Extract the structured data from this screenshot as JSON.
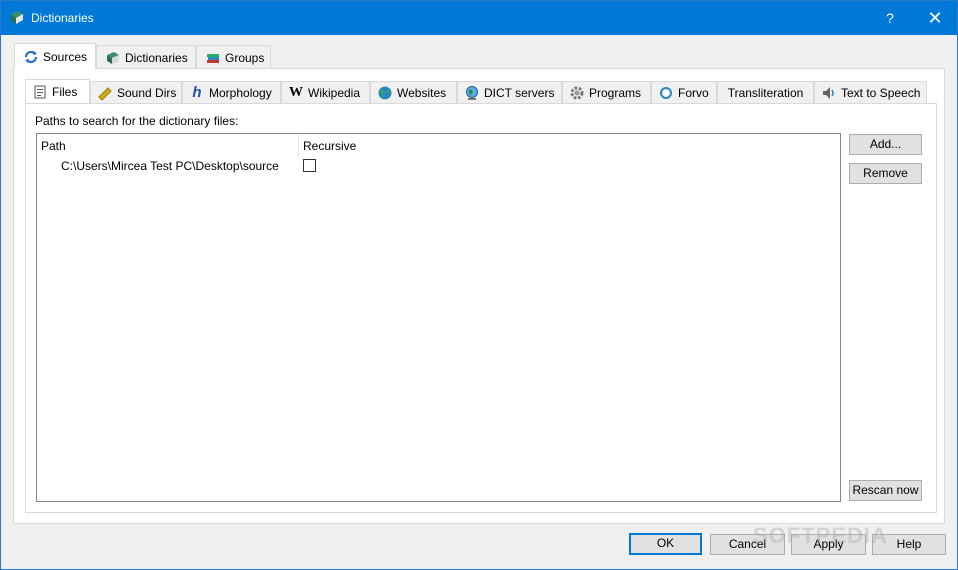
{
  "window": {
    "title": "Dictionaries",
    "help_glyph": "?",
    "close_glyph": "✕"
  },
  "outer_tabs": [
    {
      "label": "Sources",
      "icon": "sources-refresh-icon"
    },
    {
      "label": "Dictionaries",
      "icon": "book-icon"
    },
    {
      "label": "Groups",
      "icon": "books-stack-icon"
    }
  ],
  "inner_tabs": [
    {
      "label": "Files",
      "icon": "file-icon"
    },
    {
      "label": "Sound Dirs",
      "icon": "sound-dirs-icon"
    },
    {
      "label": "Morphology",
      "icon": "morphology-h-icon"
    },
    {
      "label": "Wikipedia",
      "icon": "wikipedia-w-icon"
    },
    {
      "label": "Websites",
      "icon": "globe-icon"
    },
    {
      "label": "DICT servers",
      "icon": "server-globe-icon"
    },
    {
      "label": "Programs",
      "icon": "gear-icon"
    },
    {
      "label": "Forvo",
      "icon": "forvo-icon"
    },
    {
      "label": "Transliteration",
      "icon": ""
    },
    {
      "label": "Text to Speech",
      "icon": "speaker-icon"
    }
  ],
  "files": {
    "paths_label": "Paths to search for the dictionary files:",
    "columns": {
      "path": "Path",
      "recursive": "Recursive"
    },
    "rows": [
      {
        "path": "C:\\Users\\Mircea Test PC\\Desktop\\source",
        "recursive": false
      }
    ],
    "buttons": {
      "add": "Add...",
      "remove": "Remove",
      "rescan": "Rescan now"
    }
  },
  "dialog_buttons": {
    "ok": "OK",
    "cancel": "Cancel",
    "apply": "Apply",
    "help": "Help"
  },
  "watermark": "SOFTPEDIA",
  "colors": {
    "titlebar": "#0078d7",
    "default_button_border": "#0078d7"
  }
}
